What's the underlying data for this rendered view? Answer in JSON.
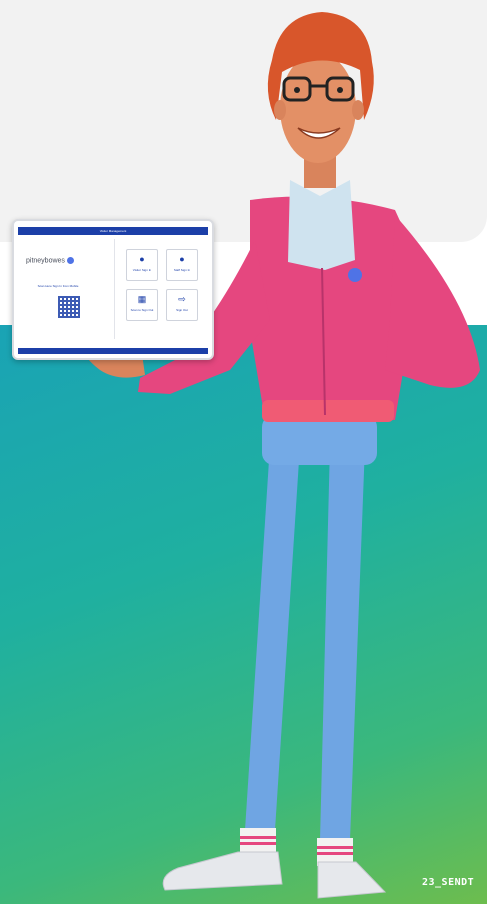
{
  "tablet": {
    "header": "Visitor Management",
    "brand": "pitneybowes",
    "qr_caption": "Scan Here Sign In from Mobile",
    "tiles": [
      {
        "icon": "person-icon",
        "label": "Visitor Sign In"
      },
      {
        "icon": "person-icon",
        "label": "Staff Sign In"
      },
      {
        "icon": "qr-scan-icon",
        "label": "Scan to Sign Out"
      },
      {
        "icon": "sign-out-icon",
        "label": "Sign Out"
      }
    ]
  },
  "image_tag": "23_SENDT",
  "colors": {
    "accent": "#1c3fa8",
    "hoodie": "#e5477f",
    "jeans": "#6fa5e3",
    "hair": "#d8562b",
    "gradient_start": "#1aa3b5",
    "gradient_end": "#6dbd4e"
  }
}
